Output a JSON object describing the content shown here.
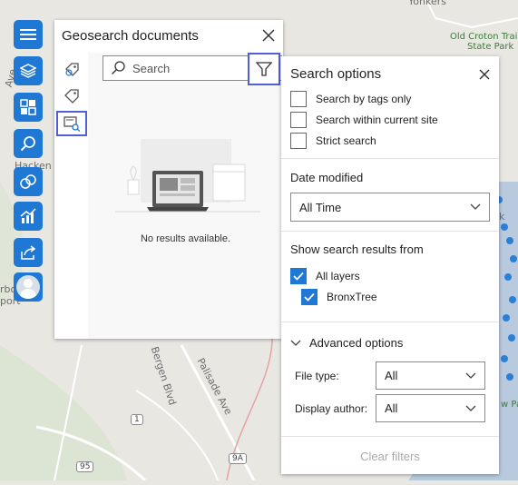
{
  "map": {
    "labels": [
      "Yonkers",
      "Old Croton Trail",
      "State Park",
      "Hacken",
      "Ave",
      "rbor",
      "port",
      "Bergen Blvd",
      "Palisade Ave",
      "k",
      "w Pa"
    ],
    "badges": [
      "1",
      "95",
      "9A"
    ]
  },
  "toolbar": {
    "items": [
      {
        "icon": "menu-icon"
      },
      {
        "icon": "layers-icon"
      },
      {
        "icon": "basemap-gallery-icon"
      },
      {
        "icon": "search-icon"
      },
      {
        "icon": "tools-icon"
      },
      {
        "icon": "analytics-icon"
      },
      {
        "icon": "share-icon"
      },
      {
        "icon": "user-avatar"
      }
    ]
  },
  "panel": {
    "title": "Geosearch documents",
    "close_icon": "close-icon",
    "side_tabs": [
      {
        "icon": "geo-tag-icon"
      },
      {
        "icon": "tag-icon"
      },
      {
        "icon": "document-search-icon",
        "active": true
      }
    ],
    "search": {
      "placeholder": "Search"
    },
    "filter_icon": "filter-icon",
    "empty_message": "No results available."
  },
  "options": {
    "title": "Search options",
    "checkboxes": [
      {
        "label": "Search by tags only",
        "checked": false
      },
      {
        "label": "Search within current site",
        "checked": false
      },
      {
        "label": "Strict search",
        "checked": false
      }
    ],
    "date_label": "Date modified",
    "date_value": "All Time",
    "show_from_label": "Show search results from",
    "layers": [
      {
        "label": "All layers",
        "checked": true
      },
      {
        "label": "BronxTree",
        "checked": true
      }
    ],
    "advanced_label": "Advanced options",
    "file_type_label": "File type:",
    "file_type_value": "All",
    "author_label": "Display author:",
    "author_value": "All",
    "clear_label": "Clear filters"
  },
  "colors": {
    "accent": "#1e78d4",
    "highlight": "#4e5fd8"
  }
}
